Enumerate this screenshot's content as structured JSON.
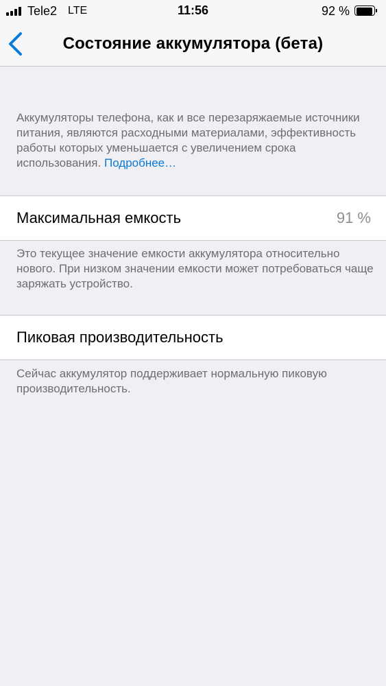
{
  "status_bar": {
    "carrier": "Tele2",
    "network": "LTE",
    "time": "11:56",
    "battery_text": "92 %",
    "battery_level": 0.92,
    "signal_bars": 4
  },
  "nav": {
    "title": "Состояние аккумулятора (бета)",
    "back_icon": "chevron-left-icon"
  },
  "intro": {
    "text": "Аккумуляторы телефона, как и все перезаряжаемые источники питания, являются расходными материалами, эффективность работы которых уменьшается с увеличением срока использования.",
    "link": "Подробнее…"
  },
  "max_capacity": {
    "label": "Максимальная емкость",
    "value": "91 %",
    "note": "Это текущее значение емкости аккумулятора относительно нового. При низком значении емкости может потребоваться чаще заряжать устройство."
  },
  "peak_performance": {
    "label": "Пиковая производительность",
    "note": "Сейчас аккумулятор поддерживает нормальную пиковую производительность."
  },
  "colors": {
    "background": "#efeff4",
    "link": "#0a7bd8",
    "secondary_text": "#6d6d72",
    "value_text": "#8e8e93",
    "back_chevron": "#0a7bd8"
  }
}
